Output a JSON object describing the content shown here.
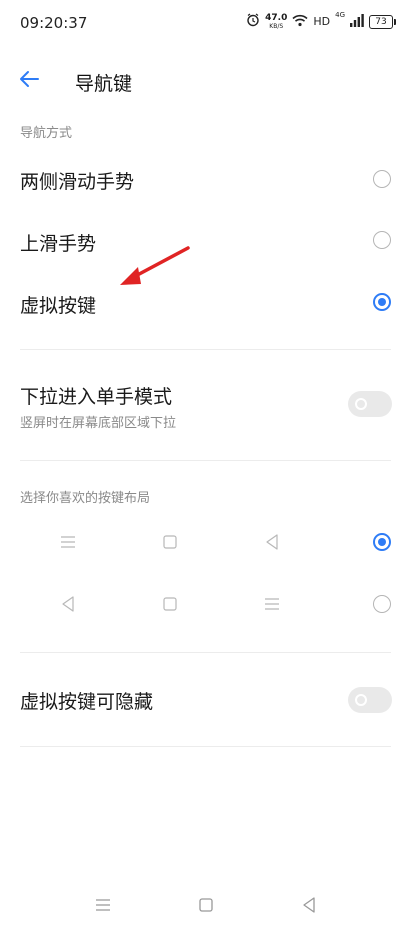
{
  "status": {
    "time": "09:20:37",
    "speed_value": "47.0",
    "speed_unit": "KB/S",
    "network": "HD",
    "signal_type": "4G",
    "battery": "73"
  },
  "header": {
    "title": "导航键"
  },
  "navigation_mode": {
    "section_label": "导航方式",
    "options": [
      {
        "label": "两侧滑动手势",
        "selected": false
      },
      {
        "label": "上滑手势",
        "selected": false
      },
      {
        "label": "虚拟按键",
        "selected": true
      }
    ]
  },
  "one_hand": {
    "label": "下拉进入单手模式",
    "sublabel": "竖屏时在屏幕底部区域下拉",
    "enabled": false
  },
  "key_layout": {
    "section_label": "选择你喜欢的按键布局",
    "options": [
      {
        "order": [
          "menu-icon",
          "home-square-icon",
          "back-triangle-icon"
        ],
        "selected": true
      },
      {
        "order": [
          "back-triangle-icon",
          "home-square-icon",
          "menu-icon"
        ],
        "selected": false
      }
    ]
  },
  "hide_keys": {
    "label": "虚拟按键可隐藏",
    "enabled": false
  },
  "colors": {
    "accent": "#2e7cf6",
    "annotation_arrow": "#e02424"
  }
}
